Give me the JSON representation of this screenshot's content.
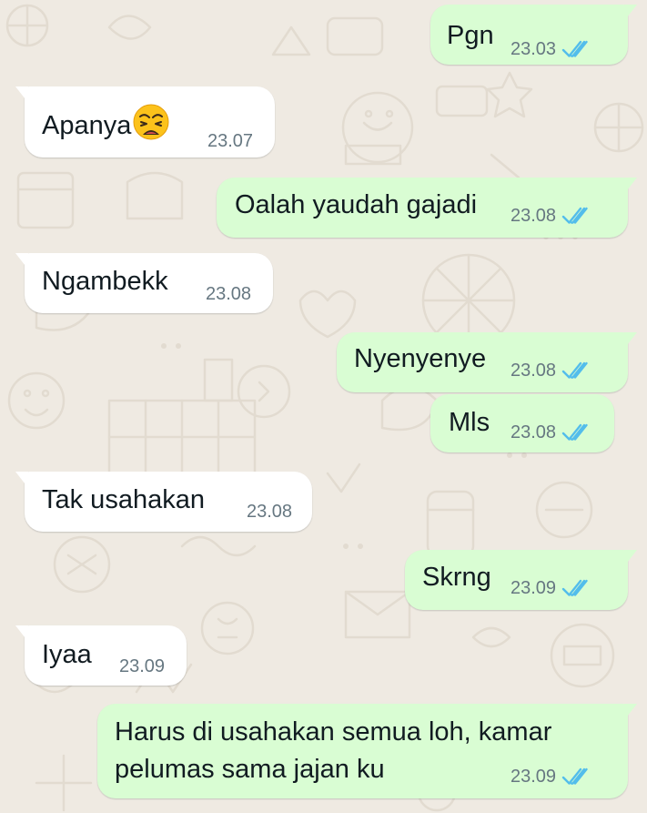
{
  "colors": {
    "chat_background": "#efeae2",
    "outgoing_bubble": "#d9fdd3",
    "incoming_bubble": "#ffffff",
    "message_text": "#111b21",
    "timestamp": "#667781",
    "read_ticks": "#53bdeb"
  },
  "messages": [
    {
      "direction": "outgoing",
      "text": "Pgn",
      "time": "23.03",
      "status": "read-double-check-icon"
    },
    {
      "direction": "incoming",
      "text": "Apanya",
      "emoji": "weary-face-icon",
      "time": "23.07"
    },
    {
      "direction": "outgoing",
      "text": "Oalah yaudah gajadi",
      "time": "23.08",
      "status": "read-double-check-icon"
    },
    {
      "direction": "incoming",
      "text": "Ngambekk",
      "time": "23.08"
    },
    {
      "direction": "outgoing",
      "text": "Nyenyenye",
      "time": "23.08",
      "status": "read-double-check-icon"
    },
    {
      "direction": "outgoing",
      "text": "Mls",
      "time": "23.08",
      "status": "read-double-check-icon"
    },
    {
      "direction": "incoming",
      "text": "Tak usahakan",
      "time": "23.08"
    },
    {
      "direction": "outgoing",
      "text": "Skrng",
      "time": "23.09",
      "status": "read-double-check-icon"
    },
    {
      "direction": "incoming",
      "text": "Iyaa",
      "time": "23.09"
    },
    {
      "direction": "outgoing",
      "text": "Harus di usahakan semua loh, kamar pelumas sama jajan ku",
      "time": "23.09",
      "status": "read-double-check-icon"
    }
  ]
}
